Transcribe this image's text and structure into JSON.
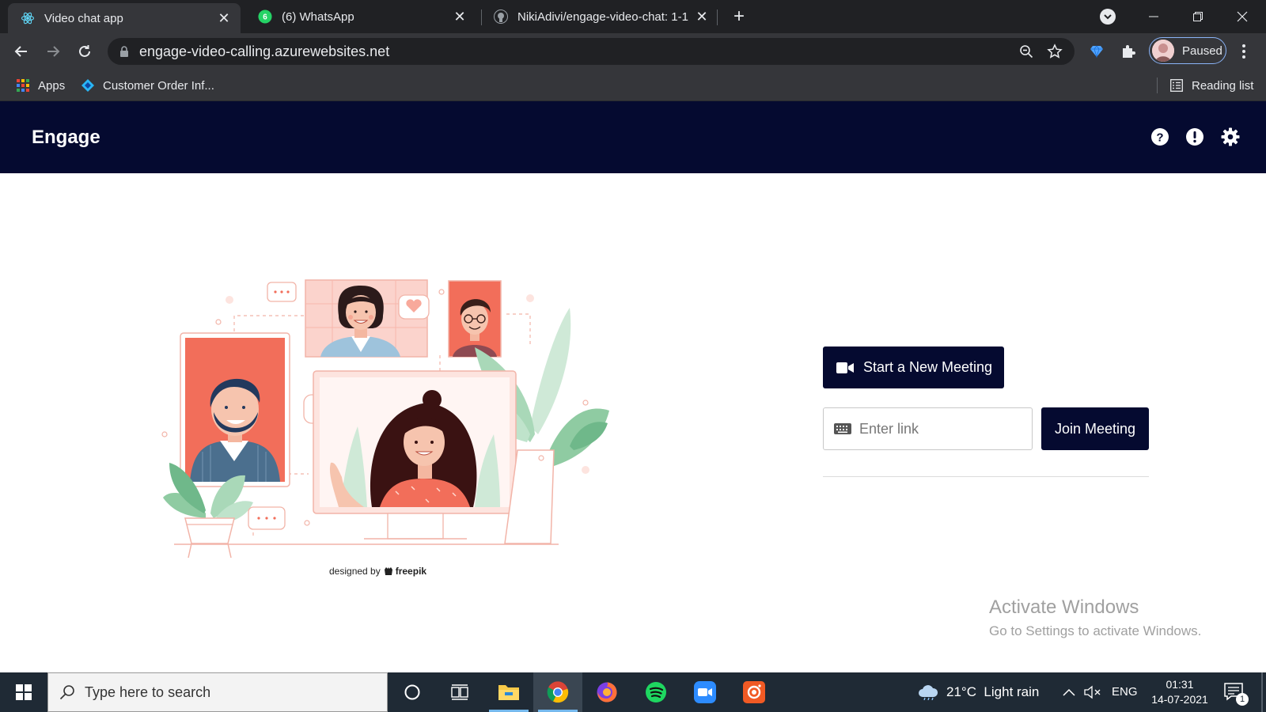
{
  "browser": {
    "tabs": [
      {
        "title": "Video chat app",
        "active": true
      },
      {
        "title": "(6) WhatsApp",
        "active": false,
        "badge": "6"
      },
      {
        "title": "NikiAdivi/engage-video-chat: 1-1",
        "active": false
      }
    ],
    "url": "engage-video-calling.azurewebsites.net",
    "profile_label": "Paused",
    "bookmarks": [
      {
        "label": "Apps"
      },
      {
        "label": "Customer Order Inf..."
      }
    ],
    "reading_list_label": "Reading list"
  },
  "app": {
    "brand": "Engage",
    "header_icons": [
      "help-icon",
      "info-alert-icon",
      "settings-gear-icon"
    ],
    "illustration_credit": {
      "prefix": "designed by",
      "brand": "freepik"
    },
    "start_meeting_label": "Start a New Meeting",
    "link_input": {
      "placeholder": "Enter link",
      "value": ""
    },
    "join_meeting_label": "Join Meeting"
  },
  "watermark": {
    "line1": "Activate Windows",
    "line2": "Go to Settings to activate Windows."
  },
  "taskbar": {
    "search_placeholder": "Type here to search",
    "apps": [
      "cortana-icon",
      "task-view-icon",
      "file-explorer-icon",
      "chrome-icon",
      "firefox-icon",
      "spotify-icon",
      "zoom-icon",
      "screen-recorder-icon"
    ],
    "weather": "21°C  Light rain",
    "language": "ENG",
    "time": "01:31",
    "date": "14-07-2021",
    "notification_count": "1"
  },
  "colors": {
    "app_navy": "#050a30",
    "chrome_dark": "#202124",
    "chrome_mid": "#35363a",
    "taskbar": "#1f2a35",
    "illustration_coral": "#f26e5a",
    "illustration_green": "#8fcba2"
  }
}
